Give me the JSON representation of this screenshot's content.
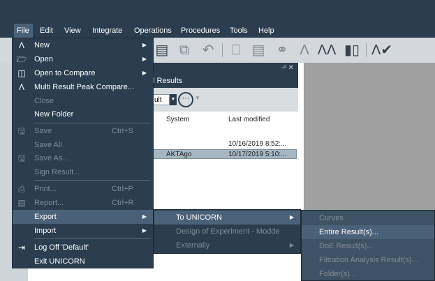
{
  "menubar": {
    "items": [
      "File",
      "Edit",
      "View",
      "Integrate",
      "Operations",
      "Procedures",
      "Tools",
      "Help"
    ],
    "active_index": 0
  },
  "toolbar": {
    "icons": [
      "document-icon",
      "copy-icon",
      "undo-icon",
      "monitor-icon",
      "notes-icon",
      "link-icon",
      "peak-icon",
      "peak-compare-icon",
      "barcode-icon",
      "sign-result-icon"
    ]
  },
  "results_panel": {
    "title": "l Results",
    "controls": "-ᵒ  ✕",
    "combo_value": "ult",
    "columns": [
      "System",
      "Last modified"
    ],
    "rows": [
      {
        "system": "",
        "last_modified": "10/16/2019 8:52:..."
      },
      {
        "system": "AKTAgo",
        "last_modified": "10/17/2019 5:10:..."
      }
    ]
  },
  "file_menu": {
    "items": [
      {
        "label": "New",
        "icon": "new-result-icon",
        "enabled": true,
        "submenu": true
      },
      {
        "label": "Open",
        "icon": "folder-open-icon",
        "enabled": true,
        "submenu": true
      },
      {
        "label": "Open to Compare",
        "icon": "compare-icon",
        "enabled": true,
        "submenu": true
      },
      {
        "label": "Multi Result Peak Compare...",
        "icon": "peak-compare-icon",
        "enabled": true
      },
      {
        "label": "Close",
        "enabled": false
      },
      {
        "label": "New Folder",
        "enabled": true
      },
      {
        "label": "Save",
        "icon": "save-icon",
        "shortcut": "Ctrl+S",
        "enabled": false
      },
      {
        "label": "Save All",
        "enabled": false
      },
      {
        "label": "Save As...",
        "icon": "save-as-icon",
        "enabled": false
      },
      {
        "label": "Sign Result...",
        "enabled": false
      },
      {
        "label": "Print...",
        "icon": "print-icon",
        "shortcut": "Ctrl+P",
        "enabled": false
      },
      {
        "label": "Report...",
        "icon": "report-icon",
        "shortcut": "Ctrl+R",
        "enabled": false
      },
      {
        "label": "Export",
        "enabled": true,
        "submenu": true,
        "highlighted": true
      },
      {
        "label": "Import",
        "enabled": true,
        "submenu": true
      },
      {
        "label": "Log Off 'Default'",
        "icon": "logoff-icon",
        "enabled": true
      },
      {
        "label": "Exit UNICORN",
        "enabled": true
      }
    ]
  },
  "export_submenu": {
    "items": [
      {
        "label": "To UNICORN",
        "enabled": true,
        "submenu": true,
        "highlighted": true
      },
      {
        "label": "Design of Experiment - Modde",
        "enabled": false
      },
      {
        "label": "Externally",
        "enabled": false,
        "submenu": true
      }
    ]
  },
  "to_unicorn_submenu": {
    "items": [
      {
        "label": "Curves",
        "enabled": false
      },
      {
        "label": "Entire Result(s)...",
        "enabled": true,
        "highlighted": true
      },
      {
        "label": "DoE Result(s)...",
        "enabled": false
      },
      {
        "label": "Filtration Analysis Result(s)...",
        "enabled": false
      },
      {
        "label": "Folder(s)...",
        "enabled": false
      }
    ]
  },
  "colors": {
    "chrome": "#2b3d4f",
    "highlight": "#4a6279",
    "disabled_text": "#7f8d9a",
    "pane_gray": "#a0a0a0"
  }
}
